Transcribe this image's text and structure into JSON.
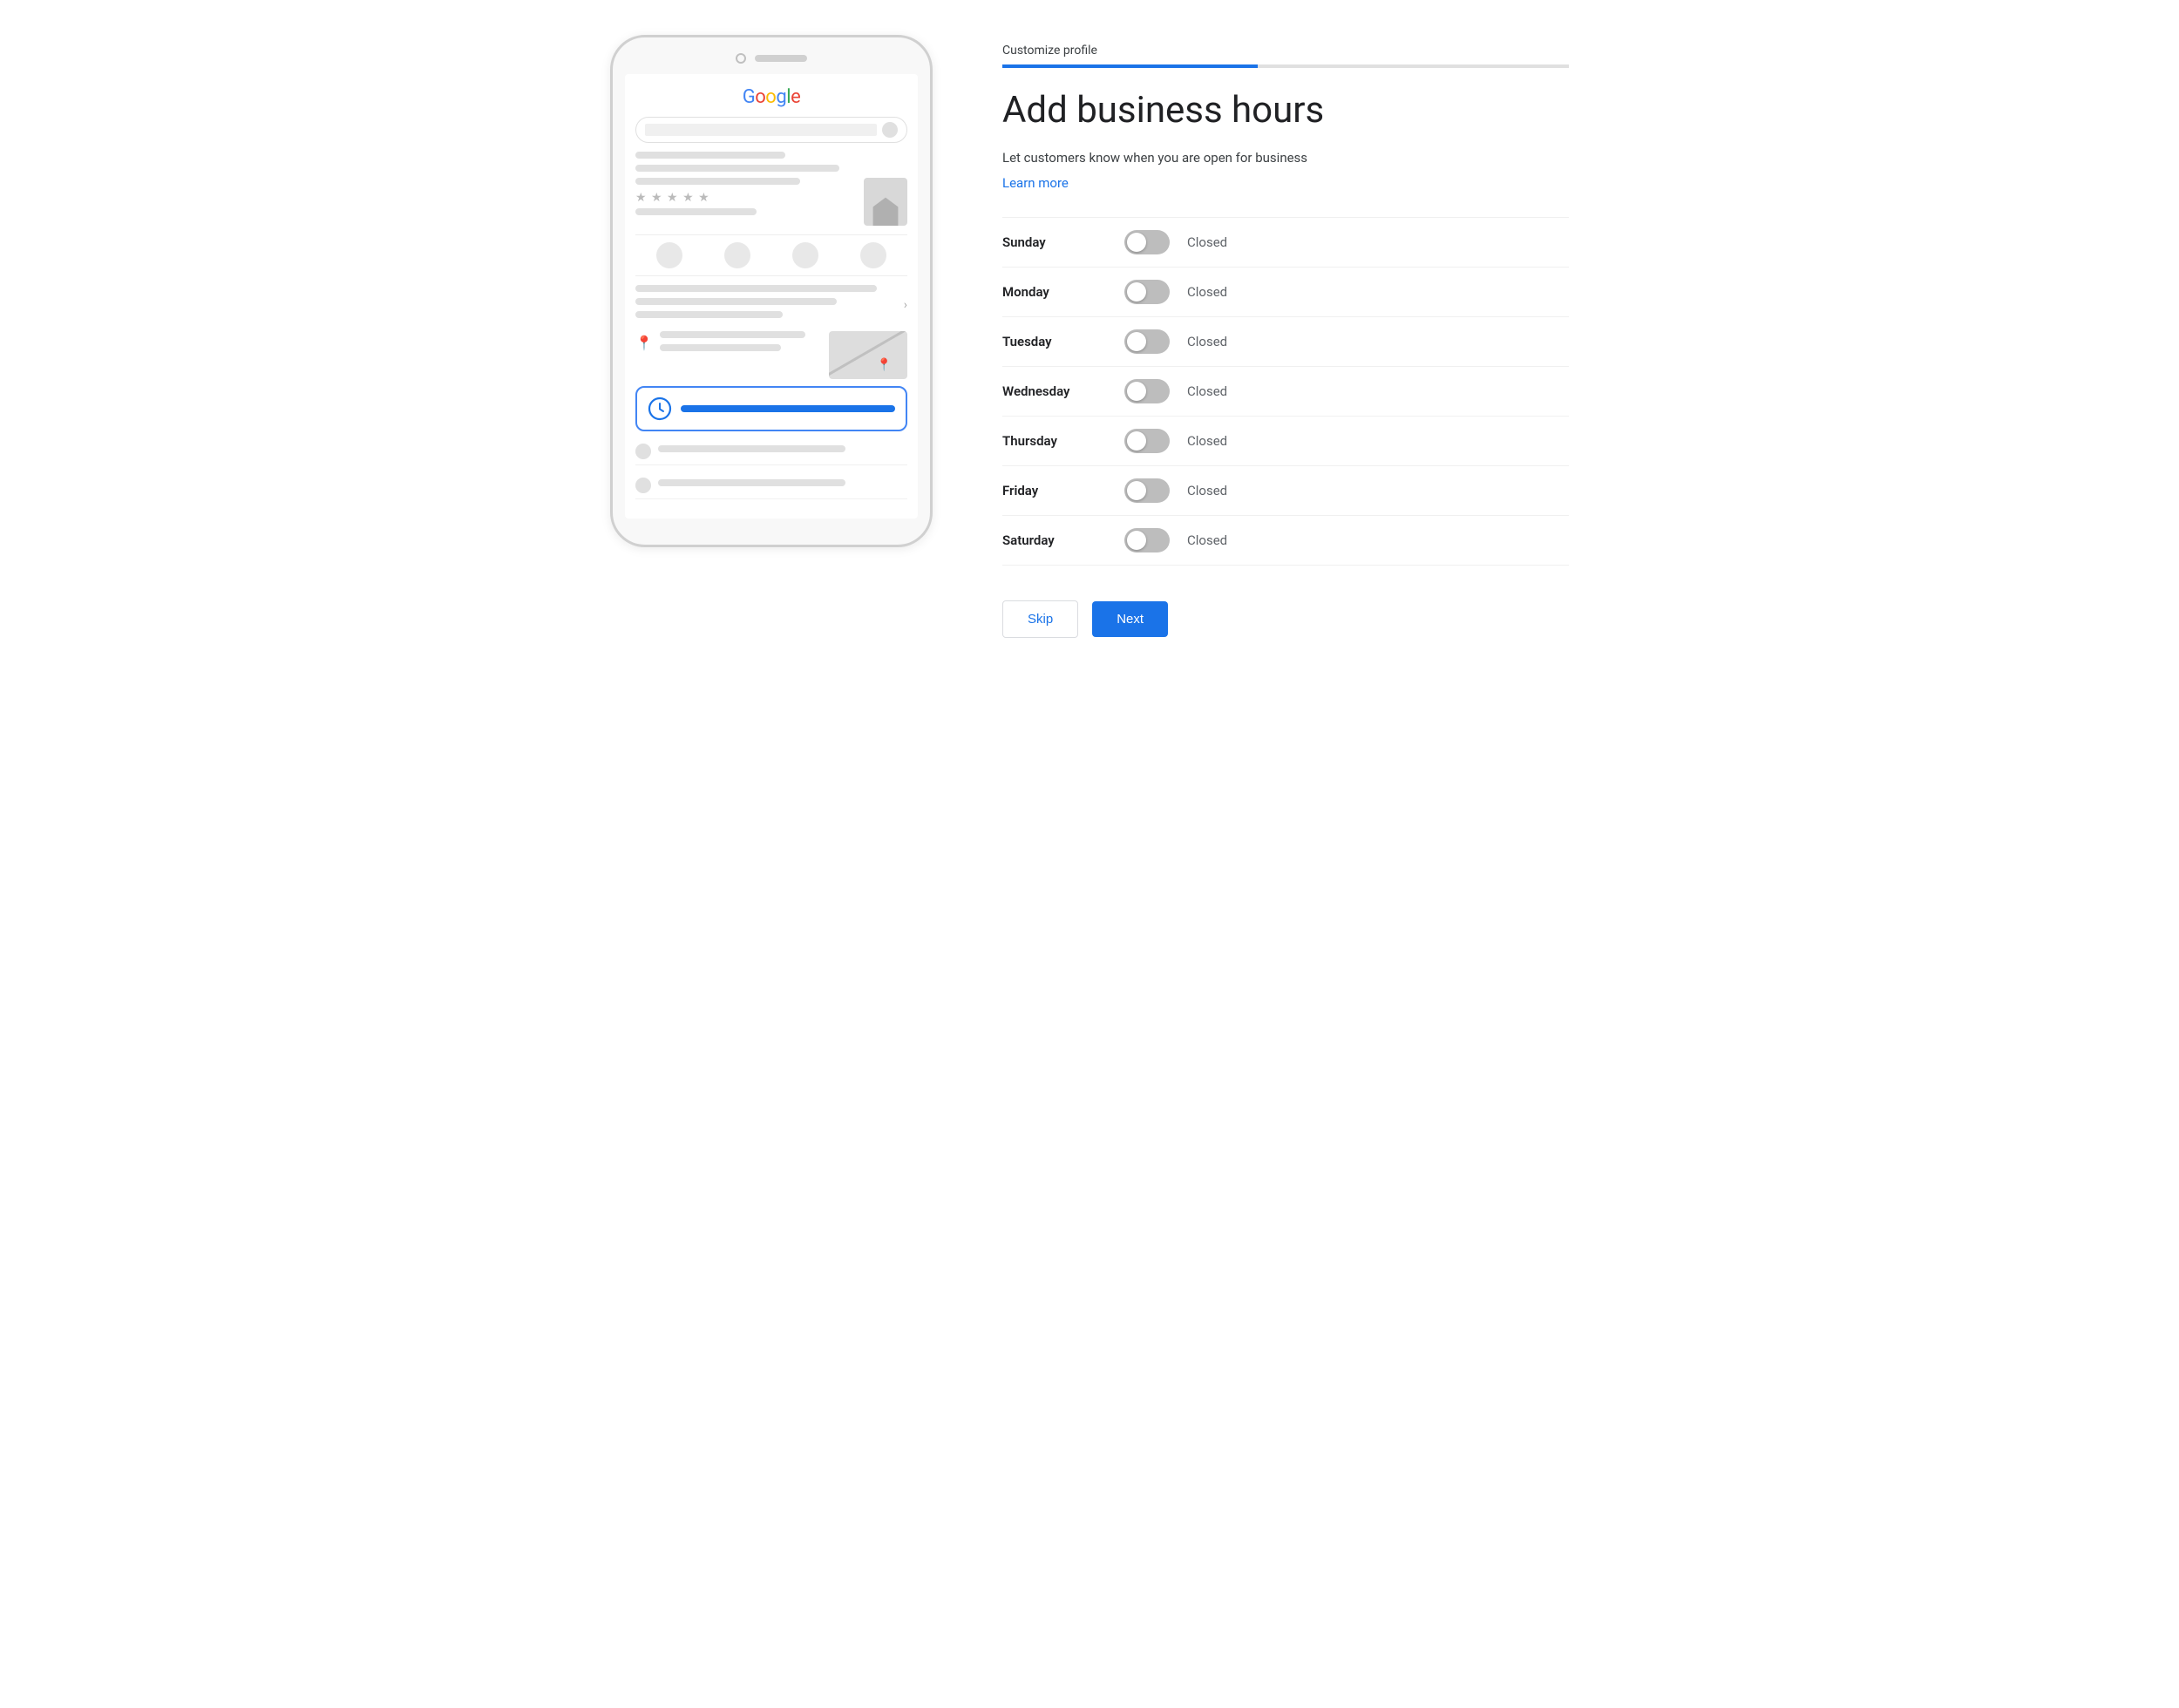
{
  "header": {
    "step_label": "Customize profile",
    "progress_percent": 45
  },
  "page": {
    "title": "Add business hours",
    "description": "Let customers know when you are open for business",
    "learn_more_label": "Learn more"
  },
  "days": [
    {
      "name": "Sunday",
      "status": "Closed",
      "open": false
    },
    {
      "name": "Monday",
      "status": "Closed",
      "open": false
    },
    {
      "name": "Tuesday",
      "status": "Closed",
      "open": false
    },
    {
      "name": "Wednesday",
      "status": "Closed",
      "open": false
    },
    {
      "name": "Thursday",
      "status": "Closed",
      "open": false
    },
    {
      "name": "Friday",
      "status": "Closed",
      "open": false
    },
    {
      "name": "Saturday",
      "status": "Closed",
      "open": false
    }
  ],
  "buttons": {
    "skip_label": "Skip",
    "next_label": "Next"
  },
  "phone": {
    "google_logo": "Google"
  }
}
